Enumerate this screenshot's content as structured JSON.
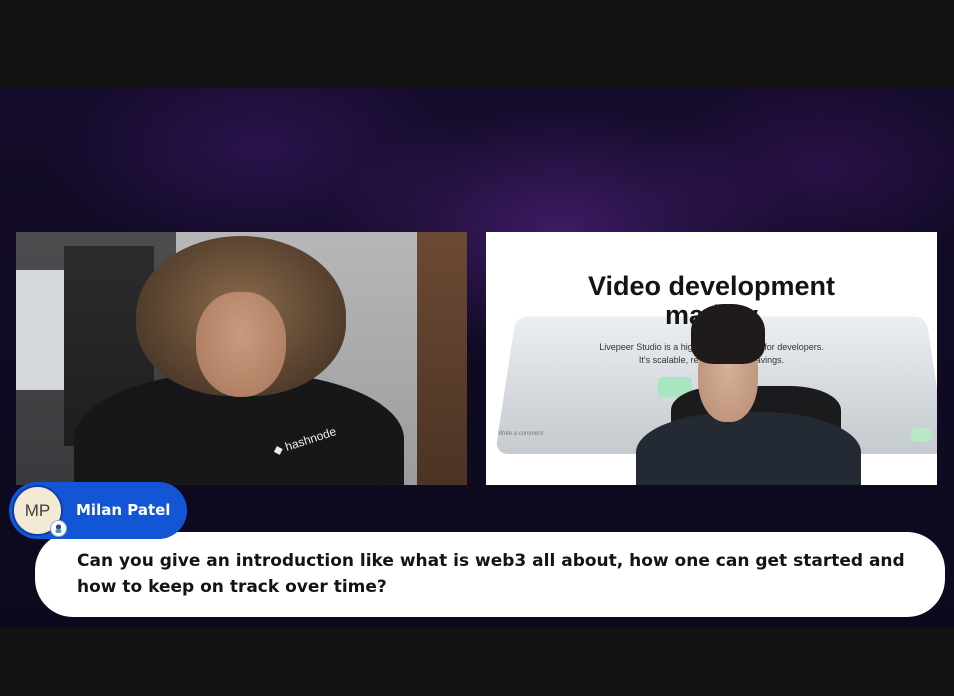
{
  "participants": {
    "left": {
      "shirt_logo": "hashnode"
    },
    "right": {
      "shared_screen": {
        "headline_line1": "Video development",
        "headline_line2": "made    y",
        "body_line1": "Livepeer Studio is a high-perform                   latform for developers.",
        "body_line2": "It's scalable, reliable, a                  cost savings.",
        "comment_placeholder": "Write a comment"
      }
    }
  },
  "caption": {
    "initials": "MP",
    "name": "Milan Patel",
    "question": "Can you give an introduction like what is web3 all about, how one can get started and how to keep on track over time?"
  },
  "colors": {
    "pill": "#1256d6",
    "card": "#ffffff",
    "letterbox": "#121212"
  }
}
